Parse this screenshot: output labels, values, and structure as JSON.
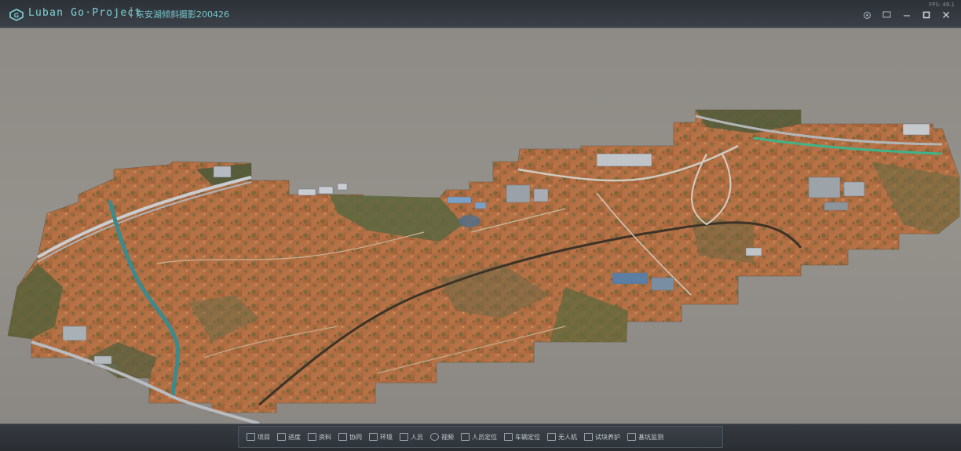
{
  "titlebar": {
    "app_name": "Luban Go·Project",
    "separator": "|",
    "project_name": "东安湖倾斜摄影200426",
    "fps_text": "FPS: 49.1"
  },
  "window_controls": [
    "settings-icon",
    "screen-icon",
    "minimize-icon",
    "maximize-icon",
    "close-icon"
  ],
  "toolbar": {
    "items": [
      {
        "label": "项目",
        "icon": "project-icon"
      },
      {
        "label": "进度",
        "icon": "progress-icon"
      },
      {
        "label": "资料",
        "icon": "document-icon"
      },
      {
        "label": "协同",
        "icon": "collaboration-icon"
      },
      {
        "label": "环境",
        "icon": "environment-icon"
      },
      {
        "label": "人员",
        "icon": "personnel-icon"
      },
      {
        "label": "视频",
        "icon": "video-icon"
      },
      {
        "label": "人员定位",
        "icon": "personnel-location-icon"
      },
      {
        "label": "车辆定位",
        "icon": "vehicle-location-icon"
      },
      {
        "label": "无人机",
        "icon": "drone-icon"
      },
      {
        "label": "试块养护",
        "icon": "test-block-icon"
      },
      {
        "label": "基坑监测",
        "icon": "pit-monitoring-icon"
      }
    ]
  },
  "colors": {
    "accent": "#7fd3d6",
    "background": "#8f8c87",
    "terrain_soil": "#b56b3c",
    "terrain_vegetation": "#5a6a3a",
    "water": "#3c8a8c"
  }
}
